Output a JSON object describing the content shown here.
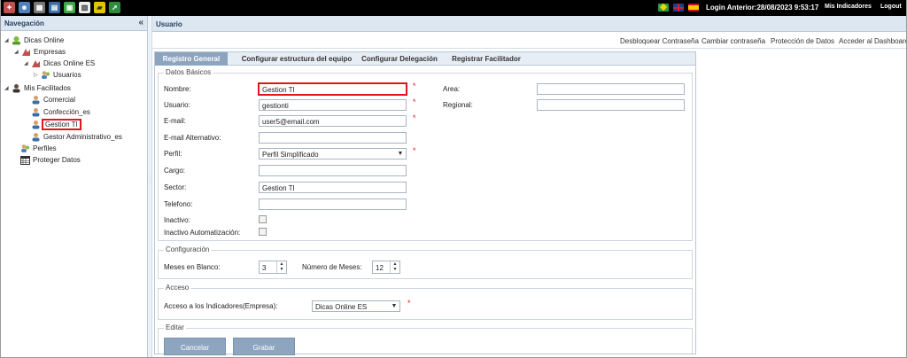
{
  "topbar": {
    "icons": [
      "tools-icon",
      "users-icon",
      "chart-icon",
      "document-icon",
      "printer-icon",
      "calendar-icon",
      "folder-icon",
      "export-icon"
    ],
    "login_label": "Login Anterior:28/08/2023 9:53:17",
    "indicators": "Mis Indicadores",
    "logout": "Logout"
  },
  "nav": {
    "title": "Navegación",
    "collapse": "«",
    "items": {
      "dicas": "Dicas Online",
      "empresas": "Empresas",
      "dicas_es": "Dicas Online ES",
      "usuarios": "Usuarios",
      "mis_facilitados": "Mis Facilitados",
      "comercial": "Comercial",
      "confeccion": "Confección_es",
      "gestion": "Gestion TI",
      "gestor": "Gestor Administrativo_es",
      "perfiles": "Perfiles",
      "proteger": "Proteger Datos"
    }
  },
  "main": {
    "title": "Usuario",
    "actions": {
      "desbloquear": "Desbloquear Contraseña",
      "cambiar": "Cambiar contraseña",
      "proteccion": "Protección de Datos",
      "dashboard": "Acceder al Dashboard"
    },
    "tabs": {
      "registro": "Registro General",
      "estructura": "Configurar estructura del equipo",
      "delegacion": "Configurar Delegación",
      "facilitador": "Registrar Facilitador"
    }
  },
  "datos": {
    "legend": "Datos Básicos",
    "nombre_label": "Nombre:",
    "nombre": "Gestion TI",
    "usuario_label": "Usuario:",
    "usuario": "gestionti",
    "email_label": "E-mail:",
    "email": "user5@email.com",
    "email_alt_label": "E-mail Alternativo:",
    "email_alt": "",
    "perfil_label": "Perfil:",
    "perfil": "Perfil Simplificado",
    "cargo_label": "Cargo:",
    "cargo": "",
    "sector_label": "Sector:",
    "sector": "Gestion TI",
    "telefono_label": "Telefono:",
    "telefono": "",
    "inactivo_label": "Inactivo:",
    "inactivo_auto_label": "Inactivo Automatización:",
    "area_label": "Area:",
    "area": "",
    "regional_label": "Regional:",
    "regional": "",
    "required": "*"
  },
  "config": {
    "legend": "Configuración",
    "meses_blanco_label": "Meses en Blanco:",
    "meses_blanco": "3",
    "num_meses_label": "Número de Meses:",
    "num_meses": "12"
  },
  "acceso": {
    "legend": "Acceso",
    "label": "Acceso a los Indicadores(Empresa):",
    "value": "Dicas Online ES"
  },
  "editar": {
    "legend": "Editar",
    "cancelar": "Cancelar",
    "grabar": "Grabar"
  },
  "colors": {
    "accent": "#8da4bf",
    "required": "#e3151c",
    "highlight": "#e3151c"
  }
}
